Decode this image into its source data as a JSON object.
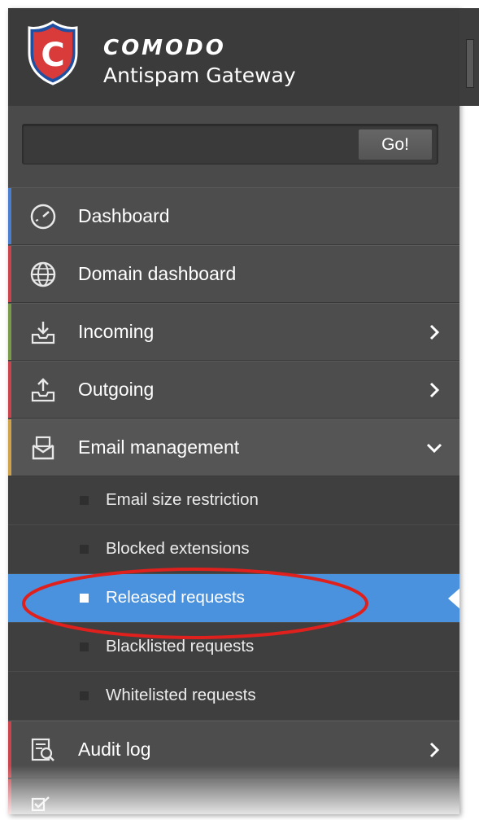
{
  "header": {
    "brand": "COMODO",
    "product": "Antispam Gateway"
  },
  "search": {
    "value": "",
    "placeholder": "",
    "button": "Go!"
  },
  "menu": [
    {
      "label": "Dashboard",
      "icon": "gauge-icon",
      "accent": "#4a7fd0"
    },
    {
      "label": "Domain dashboard",
      "icon": "globe-icon",
      "accent": "#c9444c"
    },
    {
      "label": "Incoming",
      "icon": "inbox-download-icon",
      "accent": "#7a9a4a"
    },
    {
      "label": "Outgoing",
      "icon": "outbox-upload-icon",
      "accent": "#c9444c"
    },
    {
      "label": "Email management",
      "icon": "envelope-icon",
      "accent": "#d0a34a"
    }
  ],
  "submenu": [
    {
      "label": "Email size restriction"
    },
    {
      "label": "Blocked extensions"
    },
    {
      "label": "Released requests"
    },
    {
      "label": "Blacklisted requests"
    },
    {
      "label": "Whitelisted requests"
    }
  ],
  "after": [
    {
      "label": "Audit log",
      "icon": "audit-log-icon",
      "accent": "#c9444c"
    },
    {
      "label": "",
      "icon": "checklist-icon",
      "accent": "#c9444c"
    }
  ]
}
